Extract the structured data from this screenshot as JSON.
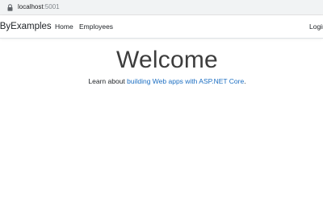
{
  "browser": {
    "url_host": "localhost",
    "url_port": ":5001"
  },
  "navbar": {
    "brand": "yByExamples",
    "links": [
      "Home",
      "Employees"
    ],
    "login": "Login"
  },
  "main": {
    "heading": "Welcome",
    "lead_prefix": "Learn about ",
    "lead_link": "building Web apps with ASP.NET Core",
    "lead_suffix": "."
  },
  "colors": {
    "link": "#1b6ec2",
    "heading": "#3d3d3d",
    "address_bar": "#f1f3f4"
  }
}
